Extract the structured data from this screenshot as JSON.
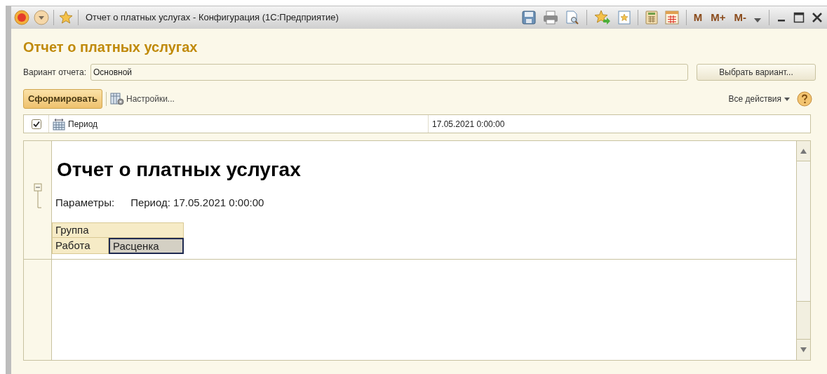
{
  "window": {
    "title": "Отчет о платных услугах - Конфигурация  (1С:Предприятие)",
    "memory_buttons": [
      "M",
      "M+",
      "M-"
    ]
  },
  "heading": "Отчет о платных услугах",
  "variant": {
    "label": "Вариант отчета:",
    "value": "Основной",
    "button": "Выбрать вариант..."
  },
  "toolbar": {
    "generate": "Сформировать",
    "settings": "Настройки...",
    "all_actions": "Все действия"
  },
  "parameters": [
    {
      "checked": true,
      "name": "Период",
      "value": "17.05.2021 0:00:00"
    }
  ],
  "report": {
    "title": "Отчет о платных услугах",
    "params_label": "Параметры:",
    "params_value": "Период: 17.05.2021 0:00:00",
    "group_expanded": true,
    "header": "Группа",
    "cells": [
      {
        "text": "Работа",
        "selected": false
      },
      {
        "text": "Расценка",
        "selected": true
      }
    ]
  }
}
